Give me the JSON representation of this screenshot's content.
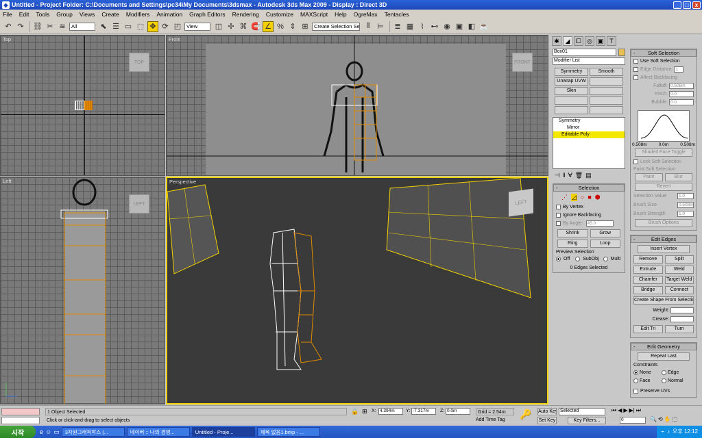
{
  "titlebar": {
    "title": "Untitled       - Project Folder: C:\\Documents and Settings\\pc34\\My Documents\\3dsmax       - Autodesk 3ds Max  2009          - Display : Direct 3D",
    "min": "_",
    "max": "□",
    "close": "x"
  },
  "menu": [
    "File",
    "Edit",
    "Tools",
    "Group",
    "Views",
    "Create",
    "Modifiers",
    "Animation",
    "Graph Editors",
    "Rendering",
    "Customize",
    "MAXScript",
    "Help",
    "OgreMax",
    "Tentacles"
  ],
  "toolbar": {
    "filter_value": "All",
    "refcoord_value": "View",
    "selection_set_placeholder": "Create Selection Set"
  },
  "viewports": {
    "top_label": "Top",
    "front_label": "Front",
    "left_label": "Left",
    "persp_label": "Perspective",
    "cube_top": "TOP",
    "cube_front": "FRONT",
    "cube_left": "LEFT",
    "cube_persp": "LEFT"
  },
  "cmdpanel": {
    "object_name": "Box01",
    "modifier_list": "Modifier List",
    "buttons": [
      "Symmetry",
      "Smooth",
      "Unwrap UVW",
      "",
      "Skin",
      ""
    ],
    "stack": [
      "Symmetry",
      "Mirror",
      "Editable Poly"
    ],
    "selection_title": "Selection",
    "by_vertex": "By Vertex",
    "ignore_backfacing": "Ignore Backfacing",
    "by_angle": "By Angle:",
    "by_angle_value": "45.0",
    "shrink": "Shrink",
    "grow": "Grow",
    "ring": "Ring",
    "loop": "Loop",
    "preview_title": "Preview Selection",
    "preview_off": "Off",
    "preview_subobj": "SubObj",
    "preview_multi": "Multi",
    "edges_selected": "0 Edges Selected"
  },
  "soft": {
    "title": "Soft Selection",
    "use_soft": "Use Soft Selection",
    "edge_distance": "Edge Distance:",
    "edge_distance_value": "1",
    "affect_backfacing": "Affect Backfacing",
    "falloff": "Falloff:",
    "falloff_value": "0.508m",
    "pinch": "Pinch:",
    "pinch_value": "0.0",
    "bubble": "Bubble:",
    "bubble_value": "0.0",
    "curve_left": "0.508m",
    "curve_mid": "0.0m",
    "curve_right": "0.508m",
    "shaded_face_toggle": "Shaded Face Toggle",
    "lock_soft": "Lock Soft Selection",
    "paint_title": "Paint Soft Selection",
    "paint": "Paint",
    "blur": "Blur",
    "revert": "Revert",
    "selection_value": "Selection Value",
    "selection_value_v": "1.0",
    "brush_size": "Brush Size",
    "brush_size_v": "0.508m",
    "brush_strength": "Brush Strength",
    "brush_strength_v": "1.0",
    "brush_options": "Brush Options"
  },
  "edges": {
    "title": "Edit Edges",
    "insert_vertex": "Insert Vertex",
    "remove": "Remove",
    "split": "Split",
    "extrude": "Extrude",
    "weld": "Weld",
    "chamfer": "Chamfer",
    "target_weld": "Target Weld",
    "bridge": "Bridge",
    "connect": "Connect",
    "create_shape": "Create Shape From Selection",
    "weight": "Weight:",
    "crease": "Crease:",
    "edit_tri": "Edit Tri",
    "turn": "Turn"
  },
  "geometry": {
    "title": "Edit Geometry",
    "repeat_last": "Repeat Last",
    "constraints": "Constraints",
    "none": "None",
    "edge": "Edge",
    "face": "Face",
    "normal": "Normal",
    "preserve_uvs": "Preserve UVs"
  },
  "status": {
    "objects_selected": "1 Object Selected",
    "prompt": "Click or click-and-drag to select objects",
    "x_label": "X:",
    "x_value": "4.394m",
    "y_label": "Y:",
    "y_value": "-7.317m",
    "z_label": "Z:",
    "z_value": "0.0m",
    "grid": "Grid = 2.54m",
    "add_time_tag": "Add Time Tag",
    "auto_key": "Auto Key",
    "set_key": "Set Key",
    "selected": "Selected",
    "key_filters": "Key Filters...",
    "frame": "0"
  },
  "taskbar": {
    "start": "시작",
    "items": [
      "3차원그래픽박스 |...",
      "네이버 :: 나의 경쟁...",
      "Untitled    - Proje...",
      "제목 없음1.bmp - ..."
    ],
    "clock": "오후 12:12"
  },
  "colors": {
    "accent_yellow": "#f0d000",
    "selection_orange": "#e08a00",
    "title_blue": "#2454c2"
  }
}
